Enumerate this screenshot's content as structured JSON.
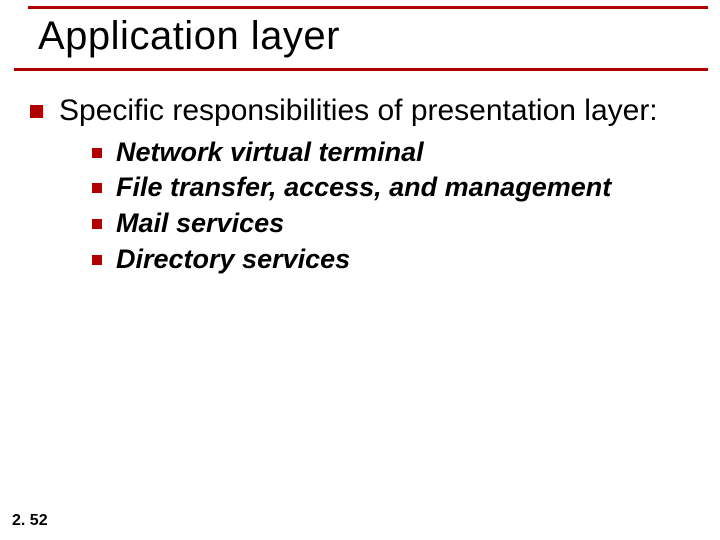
{
  "title": "Application layer",
  "main_point": "Specific responsibilities of presentation layer:",
  "sub_points": [
    "Network virtual terminal",
    "File transfer, access, and management",
    "Mail services",
    "Directory services"
  ],
  "page_number": "2. 52",
  "colors": {
    "accent": "#b00000"
  }
}
